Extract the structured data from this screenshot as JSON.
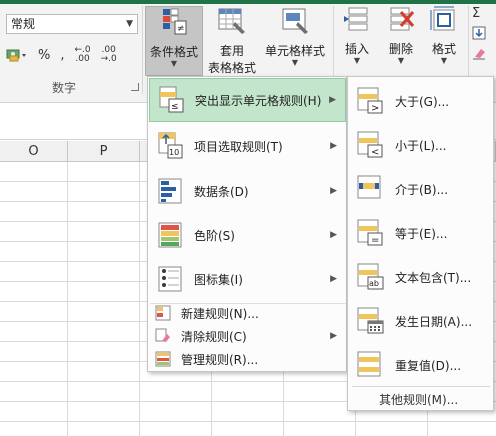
{
  "ribbon": {
    "number_format_value": "常规",
    "number_buttons": {
      "percent": "%",
      "comma": ",",
      "increase_decimal_top": "←.0",
      "increase_decimal_bottom": ".00",
      "decrease_decimal_top": ".00",
      "decrease_decimal_bottom": "→.0"
    },
    "group_number_label": "数字",
    "conditional_format_label": "条件格式",
    "table_format_label_1": "套用",
    "table_format_label_2": "表格格式",
    "cell_style_label": "单元格样式",
    "insert_label": "插入",
    "delete_label": "删除",
    "format_label": "格式",
    "sigma_icon_text": "Σ"
  },
  "sheet": {
    "columns": [
      "O",
      "P"
    ]
  },
  "main_menu": {
    "items": [
      {
        "label": "突出显示单元格规则(H)",
        "icon": "highlight-cells-rules-icon",
        "has_submenu": true,
        "highlighted": true
      },
      {
        "label": "项目选取规则(T)",
        "icon": "top-bottom-rules-icon",
        "has_submenu": true
      },
      {
        "label": "数据条(D)",
        "icon": "data-bars-icon",
        "has_submenu": true
      },
      {
        "label": "色阶(S)",
        "icon": "color-scales-icon",
        "has_submenu": true
      },
      {
        "label": "图标集(I)",
        "icon": "icon-sets-icon",
        "has_submenu": true
      }
    ],
    "small_items": [
      {
        "label": "新建规则(N)...",
        "icon": "new-rule-icon"
      },
      {
        "label": "清除规则(C)",
        "icon": "clear-rules-icon",
        "has_submenu": true
      },
      {
        "label": "管理规则(R)...",
        "icon": "manage-rules-icon"
      }
    ]
  },
  "sub_menu": {
    "items": [
      {
        "label": "大于(G)...",
        "symbol": ">"
      },
      {
        "label": "小于(L)...",
        "symbol": "<"
      },
      {
        "label": "介于(B)...",
        "symbol": ""
      },
      {
        "label": "等于(E)...",
        "symbol": "="
      },
      {
        "label": "文本包含(T)...",
        "symbol": "ab"
      },
      {
        "label": "发生日期(A)...",
        "symbol": ""
      },
      {
        "label": "重复值(D)...",
        "symbol": ""
      }
    ],
    "more_label": "其他规则(M)..."
  },
  "colors": {
    "accent_green": "#1f7346",
    "highlight_bg": "#c3e5cc",
    "highlight_border": "#8fcfa5",
    "cond_fill_yellow": "#f2c45c",
    "cond_fill_blue": "#2e5fa5"
  }
}
